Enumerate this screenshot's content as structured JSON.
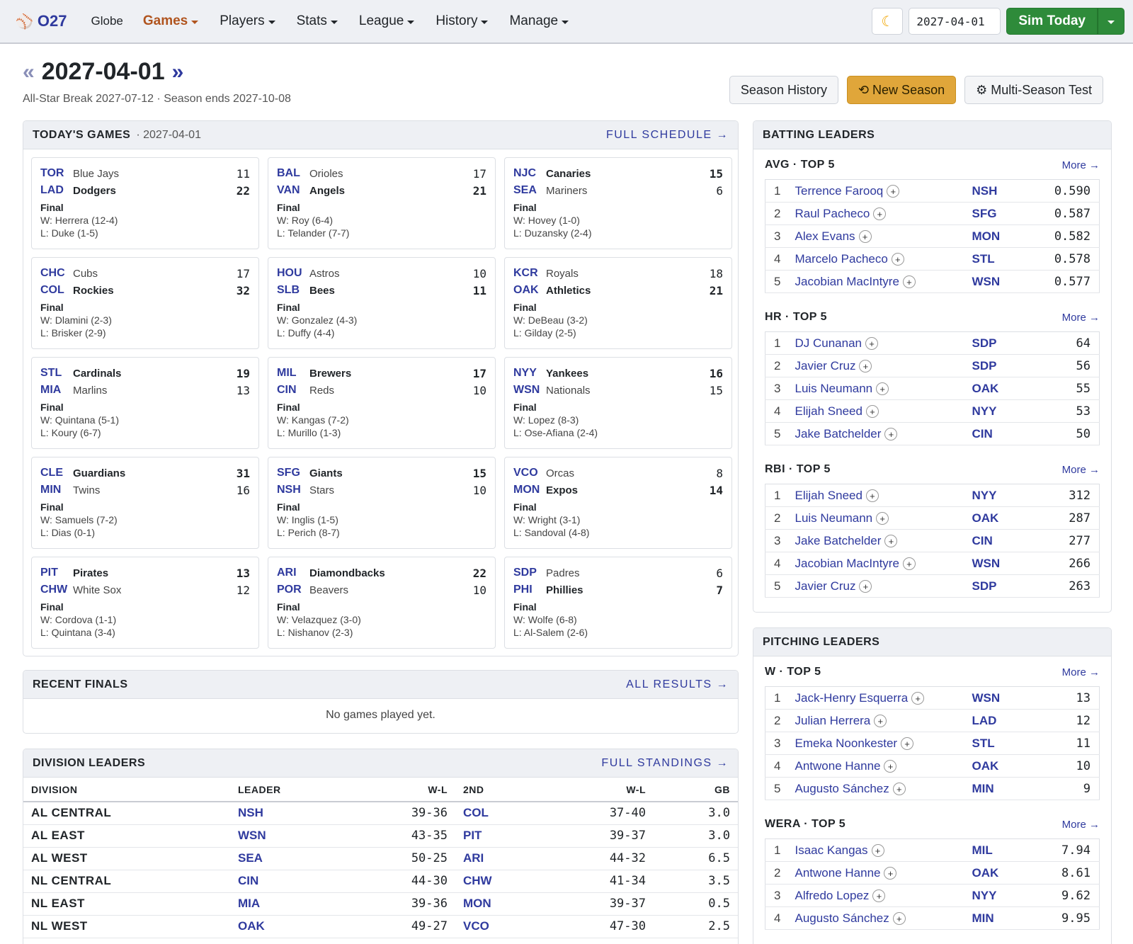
{
  "nav": {
    "brand": "O27",
    "items": [
      {
        "label": "Globe",
        "caret": false,
        "active": false
      },
      {
        "label": "Games",
        "caret": true,
        "active": true
      },
      {
        "label": "Players",
        "caret": true,
        "active": false
      },
      {
        "label": "Stats",
        "caret": true,
        "active": false
      },
      {
        "label": "League",
        "caret": true,
        "active": false
      },
      {
        "label": "History",
        "caret": true,
        "active": false
      },
      {
        "label": "Manage",
        "caret": true,
        "active": false
      }
    ],
    "date_value": "2027-04-01",
    "sim_label": "Sim Today"
  },
  "header": {
    "title": "2027-04-01",
    "prev": "«",
    "next": "»",
    "subtitle": "All-Star Break 2027-07-12 · Season ends 2027-10-08",
    "season_history": "Season History",
    "new_season": "⟲ New Season",
    "multi_season": "⚙ Multi-Season Test"
  },
  "todays_games": {
    "title": "TODAY'S GAMES",
    "date": "· 2027-04-01",
    "link": "FULL SCHEDULE →",
    "games": [
      {
        "away": {
          "abbr": "TOR",
          "name": "Blue Jays",
          "score": "11"
        },
        "home": {
          "abbr": "LAD",
          "name": "Dodgers",
          "score": "22"
        },
        "winner": "home",
        "status": "Final",
        "w": "W: Herrera (12-4)",
        "l": "L: Duke (1-5)"
      },
      {
        "away": {
          "abbr": "BAL",
          "name": "Orioles",
          "score": "17"
        },
        "home": {
          "abbr": "VAN",
          "name": "Angels",
          "score": "21"
        },
        "winner": "home",
        "status": "Final",
        "w": "W: Roy (6-4)",
        "l": "L: Telander (7-7)"
      },
      {
        "away": {
          "abbr": "NJC",
          "name": "Canaries",
          "score": "15"
        },
        "home": {
          "abbr": "SEA",
          "name": "Mariners",
          "score": "6"
        },
        "winner": "away",
        "status": "Final",
        "w": "W: Hovey (1-0)",
        "l": "L: Duzansky (2-4)"
      },
      {
        "away": {
          "abbr": "CHC",
          "name": "Cubs",
          "score": "17"
        },
        "home": {
          "abbr": "COL",
          "name": "Rockies",
          "score": "32"
        },
        "winner": "home",
        "status": "Final",
        "w": "W: Dlamini (2-3)",
        "l": "L: Brisker (2-9)"
      },
      {
        "away": {
          "abbr": "HOU",
          "name": "Astros",
          "score": "10"
        },
        "home": {
          "abbr": "SLB",
          "name": "Bees",
          "score": "11"
        },
        "winner": "home",
        "status": "Final",
        "w": "W: Gonzalez (4-3)",
        "l": "L: Duffy (4-4)"
      },
      {
        "away": {
          "abbr": "KCR",
          "name": "Royals",
          "score": "18"
        },
        "home": {
          "abbr": "OAK",
          "name": "Athletics",
          "score": "21"
        },
        "winner": "home",
        "status": "Final",
        "w": "W: DeBeau (3-2)",
        "l": "L: Gilday (2-5)"
      },
      {
        "away": {
          "abbr": "STL",
          "name": "Cardinals",
          "score": "19"
        },
        "home": {
          "abbr": "MIA",
          "name": "Marlins",
          "score": "13"
        },
        "winner": "away",
        "status": "Final",
        "w": "W: Quintana (5-1)",
        "l": "L: Koury (6-7)"
      },
      {
        "away": {
          "abbr": "MIL",
          "name": "Brewers",
          "score": "17"
        },
        "home": {
          "abbr": "CIN",
          "name": "Reds",
          "score": "10"
        },
        "winner": "away",
        "status": "Final",
        "w": "W: Kangas (7-2)",
        "l": "L: Murillo (1-3)"
      },
      {
        "away": {
          "abbr": "NYY",
          "name": "Yankees",
          "score": "16"
        },
        "home": {
          "abbr": "WSN",
          "name": "Nationals",
          "score": "15"
        },
        "winner": "away",
        "status": "Final",
        "w": "W: Lopez (8-3)",
        "l": "L: Ose-Afiana (2-4)"
      },
      {
        "away": {
          "abbr": "CLE",
          "name": "Guardians",
          "score": "31"
        },
        "home": {
          "abbr": "MIN",
          "name": "Twins",
          "score": "16"
        },
        "winner": "away",
        "status": "Final",
        "w": "W: Samuels (7-2)",
        "l": "L: Dias (0-1)"
      },
      {
        "away": {
          "abbr": "SFG",
          "name": "Giants",
          "score": "15"
        },
        "home": {
          "abbr": "NSH",
          "name": "Stars",
          "score": "10"
        },
        "winner": "away",
        "status": "Final",
        "w": "W: Inglis (1-5)",
        "l": "L: Perich (8-7)"
      },
      {
        "away": {
          "abbr": "VCO",
          "name": "Orcas",
          "score": "8"
        },
        "home": {
          "abbr": "MON",
          "name": "Expos",
          "score": "14"
        },
        "winner": "home",
        "status": "Final",
        "w": "W: Wright (3-1)",
        "l": "L: Sandoval (4-8)"
      },
      {
        "away": {
          "abbr": "PIT",
          "name": "Pirates",
          "score": "13"
        },
        "home": {
          "abbr": "CHW",
          "name": "White Sox",
          "score": "12"
        },
        "winner": "away",
        "status": "Final",
        "w": "W: Cordova (1-1)",
        "l": "L: Quintana (3-4)"
      },
      {
        "away": {
          "abbr": "ARI",
          "name": "Diamondbacks",
          "score": "22"
        },
        "home": {
          "abbr": "POR",
          "name": "Beavers",
          "score": "10"
        },
        "winner": "away",
        "status": "Final",
        "w": "W: Velazquez (3-0)",
        "l": "L: Nishanov (2-3)"
      },
      {
        "away": {
          "abbr": "SDP",
          "name": "Padres",
          "score": "6"
        },
        "home": {
          "abbr": "PHI",
          "name": "Phillies",
          "score": "7"
        },
        "winner": "home",
        "status": "Final",
        "w": "W: Wolfe (6-8)",
        "l": "L: Al-Salem (2-6)"
      }
    ]
  },
  "recent_finals": {
    "title": "RECENT FINALS",
    "link": "ALL RESULTS →",
    "empty": "No games played yet."
  },
  "division_leaders": {
    "title": "DIVISION LEADERS",
    "link": "FULL STANDINGS →",
    "headers": {
      "division": "DIVISION",
      "leader": "LEADER",
      "wl": "W-L",
      "second": "2ND",
      "wl2": "W-L",
      "gb": "GB"
    },
    "rows": [
      {
        "division": "AL CENTRAL",
        "leader": "NSH",
        "wl": "39-36",
        "second": "COL",
        "wl2": "37-40",
        "gb": "3.0"
      },
      {
        "division": "AL EAST",
        "leader": "WSN",
        "wl": "43-35",
        "second": "PIT",
        "wl2": "39-37",
        "gb": "3.0"
      },
      {
        "division": "AL WEST",
        "leader": "SEA",
        "wl": "50-25",
        "second": "ARI",
        "wl2": "44-32",
        "gb": "6.5"
      },
      {
        "division": "NL CENTRAL",
        "leader": "CIN",
        "wl": "44-30",
        "second": "CHW",
        "wl2": "41-34",
        "gb": "3.5"
      },
      {
        "division": "NL EAST",
        "leader": "MIA",
        "wl": "39-36",
        "second": "MON",
        "wl2": "39-37",
        "gb": "0.5"
      },
      {
        "division": "NL WEST",
        "leader": "OAK",
        "wl": "49-27",
        "second": "VCO",
        "wl2": "47-30",
        "gb": "2.5"
      }
    ]
  },
  "batting_leaders": {
    "title": "BATTING LEADERS",
    "sections": [
      {
        "title": "AVG · TOP 5",
        "more": "More →",
        "rows": [
          {
            "rank": "1",
            "name": "Terrence Farooq",
            "team": "NSH",
            "value": "0.590"
          },
          {
            "rank": "2",
            "name": "Raul Pacheco",
            "team": "SFG",
            "value": "0.587"
          },
          {
            "rank": "3",
            "name": "Alex Evans",
            "team": "MON",
            "value": "0.582"
          },
          {
            "rank": "4",
            "name": "Marcelo Pacheco",
            "team": "STL",
            "value": "0.578"
          },
          {
            "rank": "5",
            "name": "Jacobian MacIntyre",
            "team": "WSN",
            "value": "0.577"
          }
        ]
      },
      {
        "title": "HR · TOP 5",
        "more": "More →",
        "rows": [
          {
            "rank": "1",
            "name": "DJ Cunanan",
            "team": "SDP",
            "value": "64"
          },
          {
            "rank": "2",
            "name": "Javier Cruz",
            "team": "SDP",
            "value": "56"
          },
          {
            "rank": "3",
            "name": "Luis Neumann",
            "team": "OAK",
            "value": "55"
          },
          {
            "rank": "4",
            "name": "Elijah Sneed",
            "team": "NYY",
            "value": "53"
          },
          {
            "rank": "5",
            "name": "Jake Batchelder",
            "team": "CIN",
            "value": "50"
          }
        ]
      },
      {
        "title": "RBI · TOP 5",
        "more": "More →",
        "rows": [
          {
            "rank": "1",
            "name": "Elijah Sneed",
            "team": "NYY",
            "value": "312"
          },
          {
            "rank": "2",
            "name": "Luis Neumann",
            "team": "OAK",
            "value": "287"
          },
          {
            "rank": "3",
            "name": "Jake Batchelder",
            "team": "CIN",
            "value": "277"
          },
          {
            "rank": "4",
            "name": "Jacobian MacIntyre",
            "team": "WSN",
            "value": "266"
          },
          {
            "rank": "5",
            "name": "Javier Cruz",
            "team": "SDP",
            "value": "263"
          }
        ]
      }
    ]
  },
  "pitching_leaders": {
    "title": "PITCHING LEADERS",
    "sections": [
      {
        "title": "W · TOP 5",
        "more": "More →",
        "rows": [
          {
            "rank": "1",
            "name": "Jack-Henry Esquerra",
            "team": "WSN",
            "value": "13"
          },
          {
            "rank": "2",
            "name": "Julian Herrera",
            "team": "LAD",
            "value": "12"
          },
          {
            "rank": "3",
            "name": "Emeka Noonkester",
            "team": "STL",
            "value": "11"
          },
          {
            "rank": "4",
            "name": "Antwone Hanne",
            "team": "OAK",
            "value": "10"
          },
          {
            "rank": "5",
            "name": "Augusto Sánchez",
            "team": "MIN",
            "value": "9"
          }
        ]
      },
      {
        "title": "WERA · TOP 5",
        "more": "More →",
        "rows": [
          {
            "rank": "1",
            "name": "Isaac Kangas",
            "team": "MIL",
            "value": "7.94"
          },
          {
            "rank": "2",
            "name": "Antwone Hanne",
            "team": "OAK",
            "value": "8.61"
          },
          {
            "rank": "3",
            "name": "Alfredo Lopez",
            "team": "NYY",
            "value": "9.62"
          },
          {
            "rank": "4",
            "name": "Augusto Sánchez",
            "team": "MIN",
            "value": "9.95"
          }
        ]
      }
    ]
  }
}
